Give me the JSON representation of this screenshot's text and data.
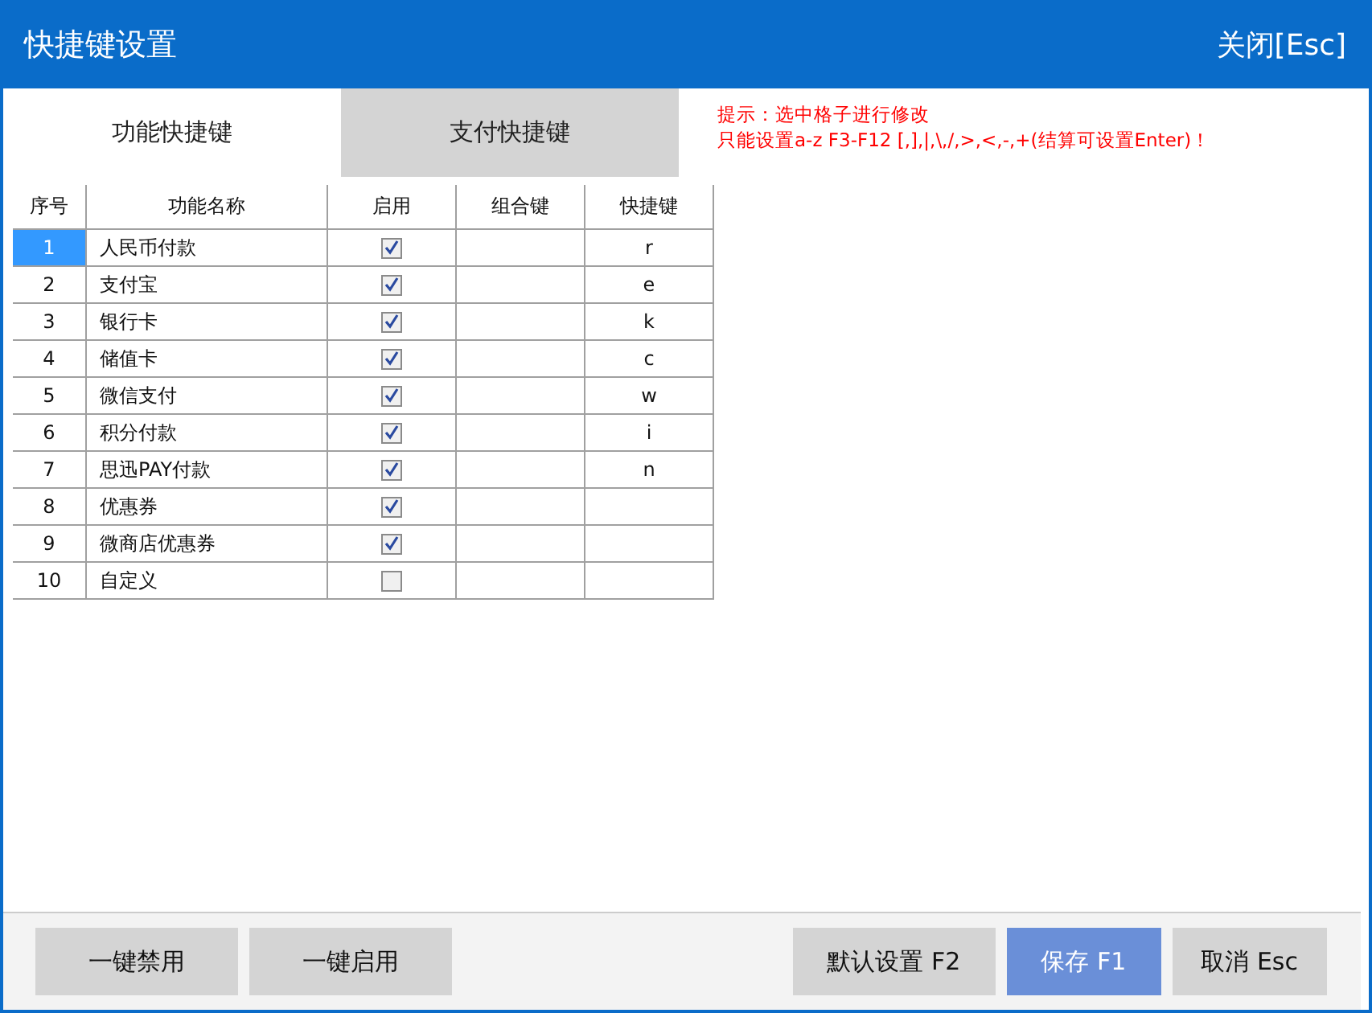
{
  "window": {
    "title": "快捷键设置",
    "close_label": "关闭[Esc]"
  },
  "tabs": [
    {
      "label": "功能快捷键",
      "selected": false
    },
    {
      "label": "支付快捷键",
      "selected": true
    }
  ],
  "hints": [
    "提示：选中格子进行修改",
    "只能设置a-z F3-F12 [,],|,\\,/,>,<,-,+(结算可设置Enter)！"
  ],
  "table": {
    "columns": [
      "序号",
      "功能名称",
      "启用",
      "组合键",
      "快捷键"
    ],
    "rows": [
      {
        "index": "1",
        "name": "人民币付款",
        "enabled": true,
        "key": "r",
        "selected": true
      },
      {
        "index": "2",
        "name": "支付宝",
        "enabled": true,
        "key": "e",
        "selected": false
      },
      {
        "index": "3",
        "name": "银行卡",
        "enabled": true,
        "key": "k",
        "selected": false
      },
      {
        "index": "4",
        "name": "储值卡",
        "enabled": true,
        "key": "c",
        "selected": false
      },
      {
        "index": "5",
        "name": "微信支付",
        "enabled": true,
        "key": "w",
        "selected": false
      },
      {
        "index": "6",
        "name": "积分付款",
        "enabled": true,
        "key": "i",
        "selected": false
      },
      {
        "index": "7",
        "name": "思迅PAY付款",
        "enabled": true,
        "key": "n",
        "selected": false
      },
      {
        "index": "8",
        "name": "优惠券",
        "enabled": true,
        "selected": false
      },
      {
        "index": "9",
        "name": "微商店优惠券",
        "enabled": true,
        "selected": false
      },
      {
        "index": "10",
        "name": "自定义",
        "enabled": false,
        "selected": false
      }
    ]
  },
  "footer": {
    "left_buttons": [
      {
        "label": "一键禁用"
      },
      {
        "label": "一键启用"
      }
    ],
    "right_buttons": [
      {
        "label": "默认设置 F2",
        "kind": "plain"
      },
      {
        "label": "保存 F1",
        "kind": "primary"
      },
      {
        "label": "取消 Esc",
        "kind": "plain"
      }
    ]
  }
}
